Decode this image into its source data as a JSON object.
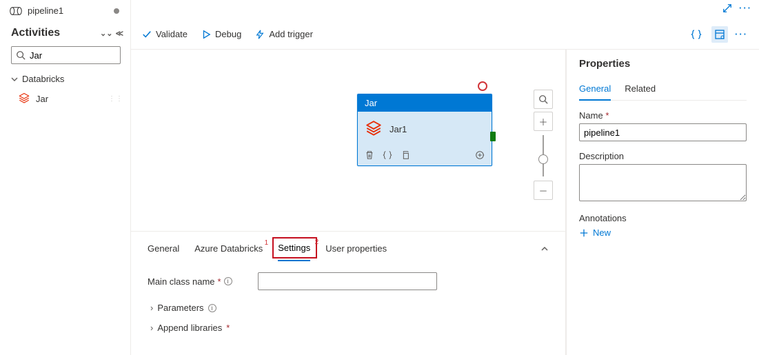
{
  "pipeline": {
    "name": "pipeline1"
  },
  "sidebar": {
    "title": "Activities",
    "search_value": "Jar",
    "category": "Databricks",
    "item_label": "Jar"
  },
  "toolbar": {
    "validate": "Validate",
    "debug": "Debug",
    "add_trigger": "Add trigger"
  },
  "activity_card": {
    "type": "Jar",
    "name": "Jar1"
  },
  "bottom_tabs": {
    "general": "General",
    "azure_databricks": "Azure Databricks",
    "settings": "Settings",
    "user_properties": "User properties",
    "hl1": "1",
    "hl2": "2"
  },
  "settings": {
    "main_class_label": "Main class name",
    "main_class_value": "",
    "parameters_label": "Parameters",
    "append_libraries_label": "Append libraries"
  },
  "properties": {
    "panel_title": "Properties",
    "tab_general": "General",
    "tab_related": "Related",
    "name_label": "Name",
    "name_value": "pipeline1",
    "description_label": "Description",
    "description_value": "",
    "annotations_label": "Annotations",
    "new_label": "New"
  }
}
